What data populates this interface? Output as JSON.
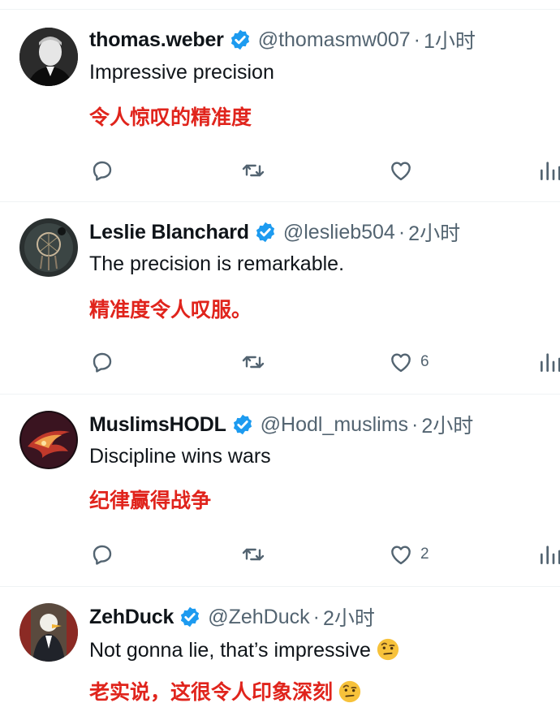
{
  "tweets": [
    {
      "name": "thomas.weber",
      "handle": "@thomasmw007",
      "separator": "·",
      "time": "1小时",
      "text": "Impressive precision",
      "translation": "令人惊叹的精准度",
      "likes": "",
      "avatar_icon": "portrait-bw"
    },
    {
      "name": "Leslie Blanchard",
      "handle": "@leslieb504",
      "separator": "·",
      "time": "2小时",
      "text": "The precision is remarkable.",
      "translation": "精准度令人叹服。",
      "likes": "6",
      "avatar_icon": "dreamcatcher"
    },
    {
      "name": "MuslimsHODL",
      "handle": "@Hodl_muslims",
      "separator": "·",
      "time": "2小时",
      "text": "Discipline wins wars",
      "translation": "纪律赢得战争",
      "likes": "2",
      "avatar_icon": "eagle-fire"
    },
    {
      "name": "ZehDuck",
      "handle": "@ZehDuck",
      "separator": "·",
      "time": "2小时",
      "text": "Not gonna lie, that’s impressive",
      "translation": "老实说，这很令人印象深刻",
      "likes": "",
      "avatar_icon": "duck-suit"
    }
  ],
  "icons": {
    "verified": "verified-badge-icon",
    "reply": "reply-icon",
    "retweet": "retweet-icon",
    "like": "heart-icon",
    "views": "views-icon",
    "emoji": "raised-eyebrow-emoji"
  },
  "colors": {
    "verified_blue": "#1d9bf0",
    "translation_red": "#e0241c",
    "muted_text": "#536471",
    "divider": "#eff3f4"
  }
}
